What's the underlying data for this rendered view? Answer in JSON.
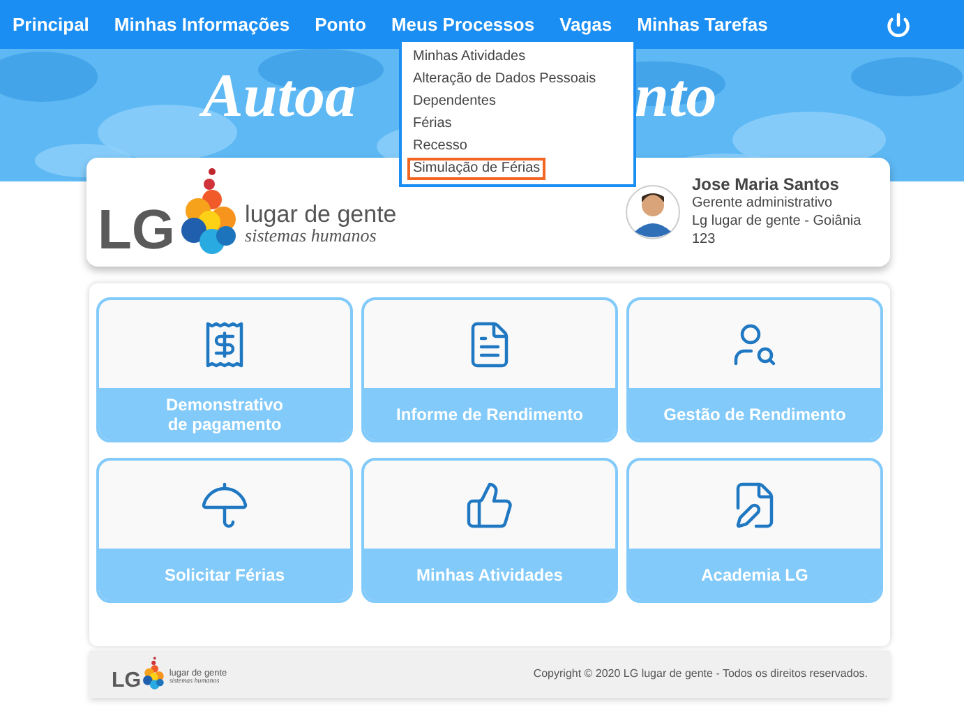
{
  "nav": {
    "items": [
      {
        "label": "Principal"
      },
      {
        "label": "Minhas Informações"
      },
      {
        "label": "Ponto"
      },
      {
        "label": "Meus Processos"
      },
      {
        "label": "Vagas"
      },
      {
        "label": "Minhas Tarefas"
      }
    ]
  },
  "dropdown": {
    "items": [
      {
        "label": "Minhas Atividades",
        "selected": false
      },
      {
        "label": "Alteração de Dados Pessoais",
        "selected": false
      },
      {
        "label": "Dependentes",
        "selected": false
      },
      {
        "label": "Férias",
        "selected": false
      },
      {
        "label": "Recesso",
        "selected": false
      },
      {
        "label": "Simulação de Férias",
        "selected": true
      }
    ]
  },
  "banner": {
    "title_parts": [
      "Autoa",
      "nto"
    ]
  },
  "logo": {
    "mark": "LG",
    "name": "lugar de gente",
    "tagline": "sistemas humanos"
  },
  "user": {
    "name": "Jose Maria Santos",
    "role": "Gerente administrativo",
    "company": "Lg lugar de gente - Goiânia",
    "code": "123"
  },
  "tiles": [
    {
      "kind": "receipt",
      "label": "Demonstrativo\nde pagamento"
    },
    {
      "kind": "document",
      "label": "Informe de Rendimento"
    },
    {
      "kind": "person-search",
      "label": "Gestão de Rendimento"
    },
    {
      "kind": "beach",
      "label": "Solicitar Férias"
    },
    {
      "kind": "thumbs-up",
      "label": "Minhas Atividades"
    },
    {
      "kind": "edit",
      "label": "Academia LG"
    }
  ],
  "footer": {
    "logo": {
      "mark": "LG",
      "name": "lugar de gente",
      "tagline": "sistemas humanos"
    },
    "copyright": "Copyright © 2020 LG lugar de gente - Todos os direitos reservados."
  }
}
